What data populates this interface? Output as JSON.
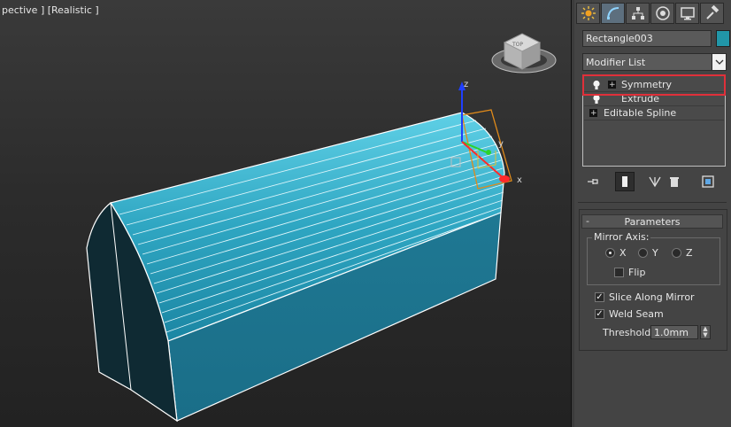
{
  "viewport": {
    "label": "pective ] [Realistic ]",
    "viewcube_face": "TOP",
    "gizmo_axes": {
      "x": "x",
      "y": "y",
      "z": "z"
    }
  },
  "command_panel": {
    "tabs": [
      {
        "name": "create",
        "icon": "sun-icon"
      },
      {
        "name": "modify",
        "icon": "modify-curve-icon",
        "active": true
      },
      {
        "name": "hierarchy",
        "icon": "hierarchy-icon"
      },
      {
        "name": "motion",
        "icon": "motion-icon"
      },
      {
        "name": "display",
        "icon": "display-monitor-icon"
      },
      {
        "name": "utilities",
        "icon": "hammer-icon"
      }
    ],
    "object_name": "Rectangle003",
    "object_color": "#2196a8",
    "modifier_list_label": "Modifier List",
    "stack": [
      {
        "label": "Symmetry",
        "has_bulb": true,
        "has_plus": true
      },
      {
        "label": "Extrude",
        "has_bulb": true,
        "has_plus": false
      },
      {
        "label": "Editable Spline",
        "has_bulb": false,
        "has_plus": true
      }
    ],
    "stack_highlight_color": "#e0303a",
    "tools": [
      "pin-stack-icon",
      "show-end-result-icon",
      "make-unique-icon",
      "remove-modifier-icon",
      "configure-modifier-sets-icon"
    ],
    "parameters": {
      "title": "Parameters",
      "collapse_symbol": "-",
      "mirror_axis_label": "Mirror Axis:",
      "axes": [
        {
          "label": "X",
          "selected": true
        },
        {
          "label": "Y",
          "selected": false
        },
        {
          "label": "Z",
          "selected": false
        }
      ],
      "flip_label": "Flip",
      "flip_checked": false,
      "slice_label": "Slice Along Mirror",
      "slice_checked": true,
      "weld_label": "Weld Seam",
      "weld_checked": true,
      "threshold_label": "Threshold:",
      "threshold_value": "1.0mm"
    }
  }
}
